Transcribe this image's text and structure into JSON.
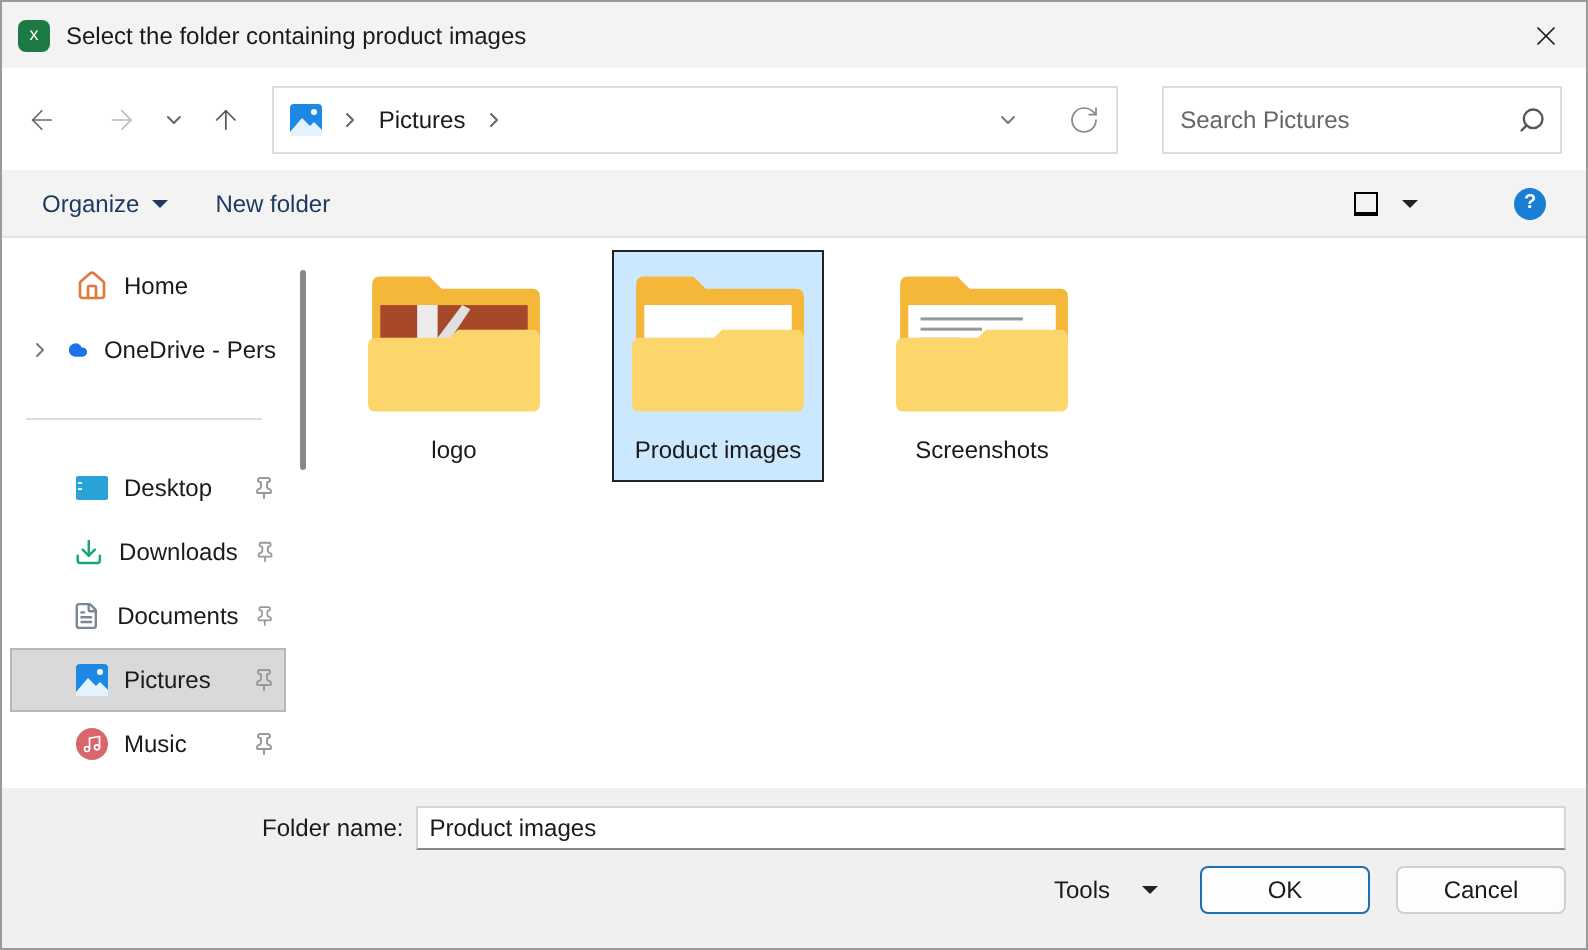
{
  "window": {
    "title": "Select the folder containing product images",
    "app_icon": "x"
  },
  "address": {
    "crumbs": [
      "Pictures"
    ]
  },
  "search": {
    "placeholder": "Search Pictures"
  },
  "toolbar": {
    "organize": "Organize",
    "new_folder": "New folder",
    "help": "?"
  },
  "sidebar": {
    "items": [
      {
        "kind": "home",
        "label": "Home",
        "pinned": false,
        "selected": false,
        "expandable": false
      },
      {
        "kind": "cloud",
        "label": "OneDrive - Pers",
        "pinned": false,
        "selected": false,
        "expandable": true
      },
      {
        "kind": "divider"
      },
      {
        "kind": "desktop",
        "label": "Desktop",
        "pinned": true,
        "selected": false,
        "expandable": false
      },
      {
        "kind": "downloads",
        "label": "Downloads",
        "pinned": true,
        "selected": false,
        "expandable": false
      },
      {
        "kind": "documents",
        "label": "Documents",
        "pinned": true,
        "selected": false,
        "expandable": false
      },
      {
        "kind": "pictures",
        "label": "Pictures",
        "pinned": true,
        "selected": true,
        "expandable": false
      },
      {
        "kind": "music",
        "label": "Music",
        "pinned": true,
        "selected": false,
        "expandable": false
      }
    ]
  },
  "folders": [
    {
      "name": "logo",
      "kind": "image",
      "selected": false
    },
    {
      "name": "Product images",
      "kind": "blank",
      "selected": true
    },
    {
      "name": "Screenshots",
      "kind": "document",
      "selected": false
    }
  ],
  "footer": {
    "folder_label": "Folder name:",
    "folder_value": "Product images",
    "tools": "Tools",
    "ok": "OK",
    "cancel": "Cancel"
  }
}
